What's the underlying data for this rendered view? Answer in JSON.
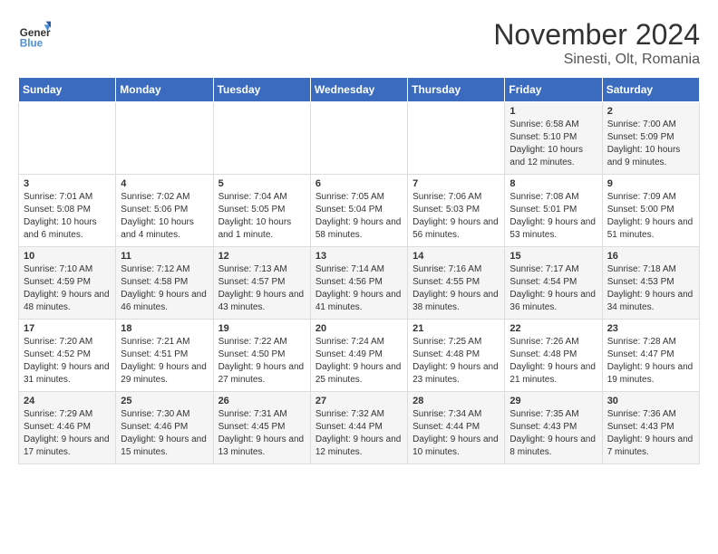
{
  "header": {
    "logo_line1": "General",
    "logo_line2": "Blue",
    "month_title": "November 2024",
    "location": "Sinesti, Olt, Romania"
  },
  "weekdays": [
    "Sunday",
    "Monday",
    "Tuesday",
    "Wednesday",
    "Thursday",
    "Friday",
    "Saturday"
  ],
  "weeks": [
    [
      {
        "day": "",
        "info": ""
      },
      {
        "day": "",
        "info": ""
      },
      {
        "day": "",
        "info": ""
      },
      {
        "day": "",
        "info": ""
      },
      {
        "day": "",
        "info": ""
      },
      {
        "day": "1",
        "info": "Sunrise: 6:58 AM\nSunset: 5:10 PM\nDaylight: 10 hours and 12 minutes."
      },
      {
        "day": "2",
        "info": "Sunrise: 7:00 AM\nSunset: 5:09 PM\nDaylight: 10 hours and 9 minutes."
      }
    ],
    [
      {
        "day": "3",
        "info": "Sunrise: 7:01 AM\nSunset: 5:08 PM\nDaylight: 10 hours and 6 minutes."
      },
      {
        "day": "4",
        "info": "Sunrise: 7:02 AM\nSunset: 5:06 PM\nDaylight: 10 hours and 4 minutes."
      },
      {
        "day": "5",
        "info": "Sunrise: 7:04 AM\nSunset: 5:05 PM\nDaylight: 10 hours and 1 minute."
      },
      {
        "day": "6",
        "info": "Sunrise: 7:05 AM\nSunset: 5:04 PM\nDaylight: 9 hours and 58 minutes."
      },
      {
        "day": "7",
        "info": "Sunrise: 7:06 AM\nSunset: 5:03 PM\nDaylight: 9 hours and 56 minutes."
      },
      {
        "day": "8",
        "info": "Sunrise: 7:08 AM\nSunset: 5:01 PM\nDaylight: 9 hours and 53 minutes."
      },
      {
        "day": "9",
        "info": "Sunrise: 7:09 AM\nSunset: 5:00 PM\nDaylight: 9 hours and 51 minutes."
      }
    ],
    [
      {
        "day": "10",
        "info": "Sunrise: 7:10 AM\nSunset: 4:59 PM\nDaylight: 9 hours and 48 minutes."
      },
      {
        "day": "11",
        "info": "Sunrise: 7:12 AM\nSunset: 4:58 PM\nDaylight: 9 hours and 46 minutes."
      },
      {
        "day": "12",
        "info": "Sunrise: 7:13 AM\nSunset: 4:57 PM\nDaylight: 9 hours and 43 minutes."
      },
      {
        "day": "13",
        "info": "Sunrise: 7:14 AM\nSunset: 4:56 PM\nDaylight: 9 hours and 41 minutes."
      },
      {
        "day": "14",
        "info": "Sunrise: 7:16 AM\nSunset: 4:55 PM\nDaylight: 9 hours and 38 minutes."
      },
      {
        "day": "15",
        "info": "Sunrise: 7:17 AM\nSunset: 4:54 PM\nDaylight: 9 hours and 36 minutes."
      },
      {
        "day": "16",
        "info": "Sunrise: 7:18 AM\nSunset: 4:53 PM\nDaylight: 9 hours and 34 minutes."
      }
    ],
    [
      {
        "day": "17",
        "info": "Sunrise: 7:20 AM\nSunset: 4:52 PM\nDaylight: 9 hours and 31 minutes."
      },
      {
        "day": "18",
        "info": "Sunrise: 7:21 AM\nSunset: 4:51 PM\nDaylight: 9 hours and 29 minutes."
      },
      {
        "day": "19",
        "info": "Sunrise: 7:22 AM\nSunset: 4:50 PM\nDaylight: 9 hours and 27 minutes."
      },
      {
        "day": "20",
        "info": "Sunrise: 7:24 AM\nSunset: 4:49 PM\nDaylight: 9 hours and 25 minutes."
      },
      {
        "day": "21",
        "info": "Sunrise: 7:25 AM\nSunset: 4:48 PM\nDaylight: 9 hours and 23 minutes."
      },
      {
        "day": "22",
        "info": "Sunrise: 7:26 AM\nSunset: 4:48 PM\nDaylight: 9 hours and 21 minutes."
      },
      {
        "day": "23",
        "info": "Sunrise: 7:28 AM\nSunset: 4:47 PM\nDaylight: 9 hours and 19 minutes."
      }
    ],
    [
      {
        "day": "24",
        "info": "Sunrise: 7:29 AM\nSunset: 4:46 PM\nDaylight: 9 hours and 17 minutes."
      },
      {
        "day": "25",
        "info": "Sunrise: 7:30 AM\nSunset: 4:46 PM\nDaylight: 9 hours and 15 minutes."
      },
      {
        "day": "26",
        "info": "Sunrise: 7:31 AM\nSunset: 4:45 PM\nDaylight: 9 hours and 13 minutes."
      },
      {
        "day": "27",
        "info": "Sunrise: 7:32 AM\nSunset: 4:44 PM\nDaylight: 9 hours and 12 minutes."
      },
      {
        "day": "28",
        "info": "Sunrise: 7:34 AM\nSunset: 4:44 PM\nDaylight: 9 hours and 10 minutes."
      },
      {
        "day": "29",
        "info": "Sunrise: 7:35 AM\nSunset: 4:43 PM\nDaylight: 9 hours and 8 minutes."
      },
      {
        "day": "30",
        "info": "Sunrise: 7:36 AM\nSunset: 4:43 PM\nDaylight: 9 hours and 7 minutes."
      }
    ]
  ]
}
